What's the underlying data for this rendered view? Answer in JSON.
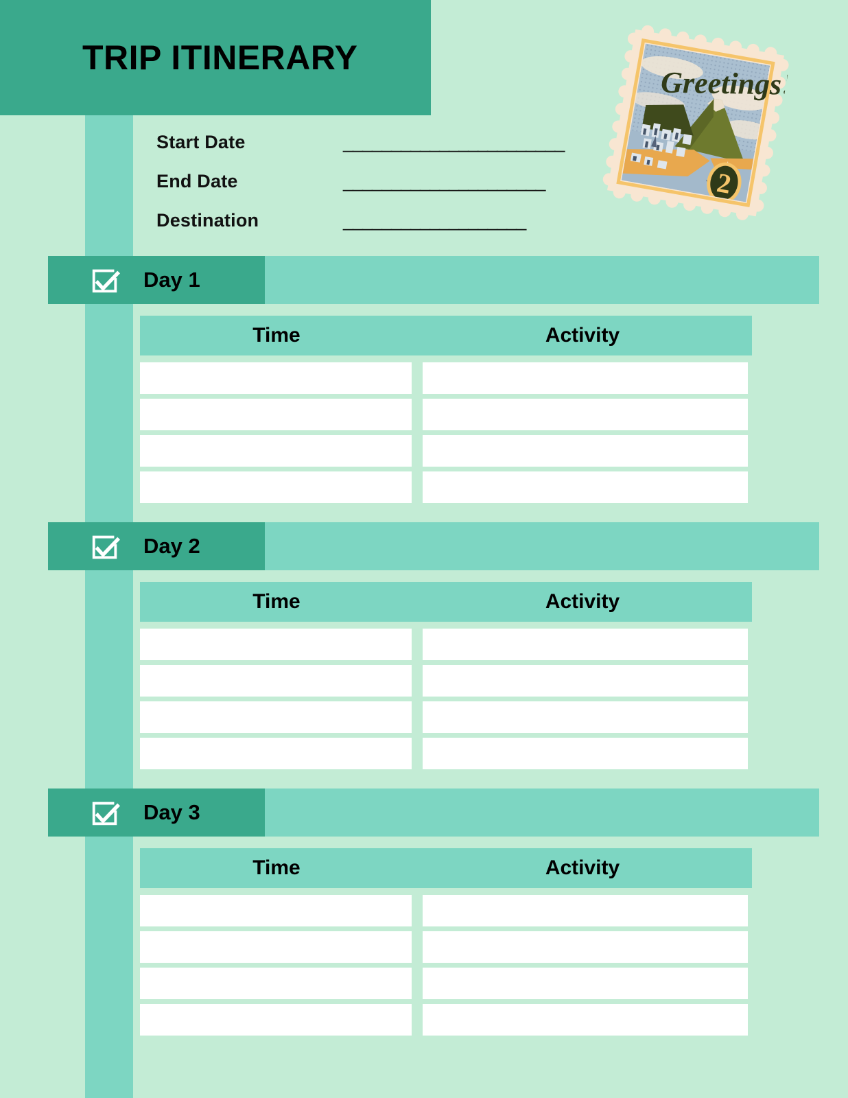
{
  "page": {
    "title": "TRIP ITINERARY",
    "background_color": "#c3ecd5",
    "accent_dark": "#3aa98c",
    "accent_medium": "#7dd6c2",
    "cell_color": "#ffffff"
  },
  "header": {
    "title": "TRIP ITINERARY"
  },
  "stamp": {
    "greeting_text": "Greetings!",
    "denomination": "2",
    "border_color": "#f7e3cc",
    "frame_color": "#f5c46a",
    "sky_color": "#a8bccd",
    "mountain_color": "#6e7a2e",
    "sand_color": "#e8a84e"
  },
  "info": {
    "fields": [
      {
        "label": "Start Date",
        "line": "_______________________"
      },
      {
        "label": "End Date",
        "line": "_____________________"
      },
      {
        "label": "Destination",
        "line": "___________________"
      }
    ]
  },
  "table": {
    "columns": [
      "Time",
      "Activity"
    ],
    "rows_per_day": 4
  },
  "days": [
    {
      "label": "Day 1",
      "checkbox_icon": "checkbox-checked-icon",
      "columns": {
        "time": "Time",
        "activity": "Activity"
      },
      "rows": [
        {
          "time": "",
          "activity": ""
        },
        {
          "time": "",
          "activity": ""
        },
        {
          "time": "",
          "activity": ""
        },
        {
          "time": "",
          "activity": ""
        }
      ]
    },
    {
      "label": "Day 2",
      "checkbox_icon": "checkbox-checked-icon",
      "columns": {
        "time": "Time",
        "activity": "Activity"
      },
      "rows": [
        {
          "time": "",
          "activity": ""
        },
        {
          "time": "",
          "activity": ""
        },
        {
          "time": "",
          "activity": ""
        },
        {
          "time": "",
          "activity": ""
        }
      ]
    },
    {
      "label": "Day 3",
      "checkbox_icon": "checkbox-checked-icon",
      "columns": {
        "time": "Time",
        "activity": "Activity"
      },
      "rows": [
        {
          "time": "",
          "activity": ""
        },
        {
          "time": "",
          "activity": ""
        },
        {
          "time": "",
          "activity": ""
        },
        {
          "time": "",
          "activity": ""
        }
      ]
    }
  ]
}
